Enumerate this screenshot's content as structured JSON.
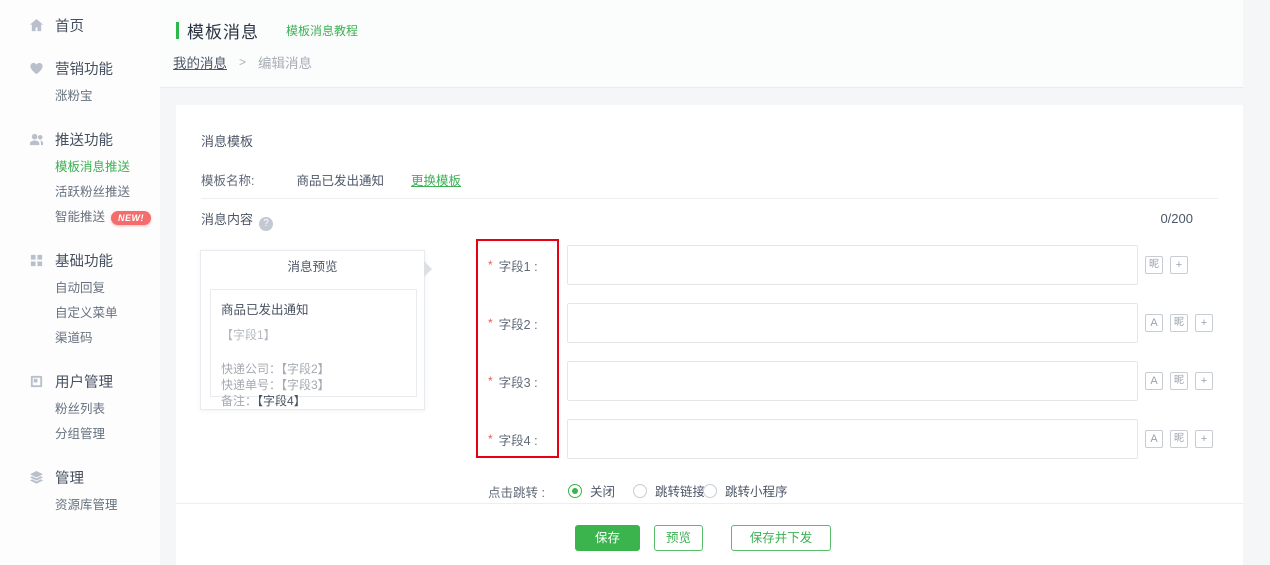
{
  "colors": {
    "accent_green": "#3bb44e",
    "link_green": "#3db155",
    "annotation_red": "#e60012",
    "badge_red": "#f56c6c",
    "required_red": "#ed5a4e"
  },
  "sidebar": {
    "home": {
      "label": "首页"
    },
    "sections": [
      {
        "label": "营销功能",
        "items": [
          {
            "label": "涨粉宝"
          }
        ]
      },
      {
        "label": "推送功能",
        "items": [
          {
            "label": "模板消息推送",
            "active": true
          },
          {
            "label": "活跃粉丝推送"
          },
          {
            "label": "智能推送",
            "badge": "NEW!"
          }
        ]
      },
      {
        "label": "基础功能",
        "items": [
          {
            "label": "自动回复"
          },
          {
            "label": "自定义菜单"
          },
          {
            "label": "渠道码"
          }
        ]
      },
      {
        "label": "用户管理",
        "items": [
          {
            "label": "粉丝列表"
          },
          {
            "label": "分组管理"
          }
        ]
      },
      {
        "label": "管理",
        "items": [
          {
            "label": "资源库管理"
          }
        ]
      }
    ]
  },
  "header": {
    "title": "模板消息",
    "tutorial_link": "模板消息教程",
    "breadcrumb": {
      "parent": "我的消息",
      "separator": ">",
      "current": "编辑消息"
    }
  },
  "template_section": {
    "title": "消息模板",
    "name_label": "模板名称:",
    "name_value": "商品已发出通知",
    "change_link": "更换模板"
  },
  "content_section": {
    "title": "消息内容",
    "help_glyph": "?",
    "counter": "0/200"
  },
  "preview": {
    "title": "消息预览",
    "message_title": "商品已发出通知",
    "field1_placeholder": "【字段1】",
    "line_company": "快递公司：【字段2】",
    "line_tracking": "快递单号：【字段3】",
    "line_note_label": "备注：",
    "line_note_value": "【字段4】"
  },
  "fields": {
    "required_marker": "*",
    "rows": [
      {
        "label": "字段1 :",
        "value": ""
      },
      {
        "label": "字段2 :",
        "value": ""
      },
      {
        "label": "字段3 :",
        "value": ""
      },
      {
        "label": "字段4 :",
        "value": ""
      }
    ],
    "tools": {
      "color_glyph": "A",
      "nickname_glyph": "昵",
      "insert_glyph": "+"
    }
  },
  "jump": {
    "label": "点击跳转 :",
    "options": [
      {
        "label": "关闭",
        "selected": true
      },
      {
        "label": "跳转链接",
        "selected": false
      },
      {
        "label": "跳转小程序",
        "selected": false
      }
    ]
  },
  "actions": {
    "save": "保存",
    "preview": "预览",
    "save_and_send": "保存并下发"
  }
}
